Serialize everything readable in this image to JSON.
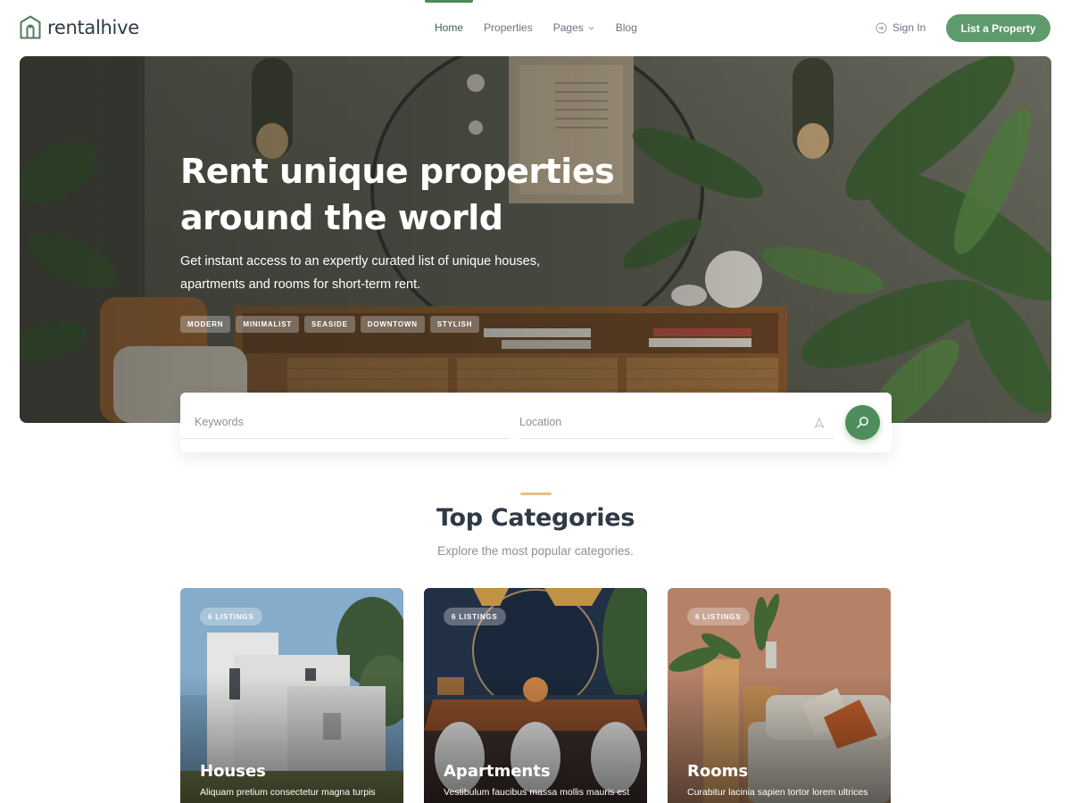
{
  "brand": {
    "name": "rentalhive",
    "accent": "#4f8d5d"
  },
  "nav": {
    "items": [
      {
        "label": "Home",
        "active": true
      },
      {
        "label": "Properties",
        "active": false
      },
      {
        "label": "Pages",
        "active": false,
        "has_dropdown": true
      },
      {
        "label": "Blog",
        "active": false
      }
    ],
    "sign_in": "Sign In",
    "cta": "List a Property"
  },
  "hero": {
    "title_line1": "Rent unique properties",
    "title_line2": "around the world",
    "subtitle_line1": "Get instant access to an expertly curated list of unique houses,",
    "subtitle_line2": "apartments and rooms for short-term rent.",
    "tags": [
      "MODERN",
      "MINIMALIST",
      "SEASIDE",
      "DOWNTOWN",
      "STYLISH"
    ]
  },
  "search": {
    "keywords_placeholder": "Keywords",
    "location_placeholder": "Location",
    "location_icon": "location-arrow-icon",
    "button_icon": "search-icon"
  },
  "categories": {
    "title": "Top Categories",
    "subtitle": "Explore the most popular categories.",
    "accent": "#e7c27c",
    "items": [
      {
        "badge": "6 LISTINGS",
        "title": "Houses",
        "desc": "Aliquam pretium consectetur magna turpis"
      },
      {
        "badge": "6 LISTINGS",
        "title": "Apartments",
        "desc": "Vestibulum faucibus massa mollis mauris est"
      },
      {
        "badge": "6 LISTINGS",
        "title": "Rooms",
        "desc": "Curabitur lacinia sapien tortor lorem ultrices"
      }
    ]
  }
}
